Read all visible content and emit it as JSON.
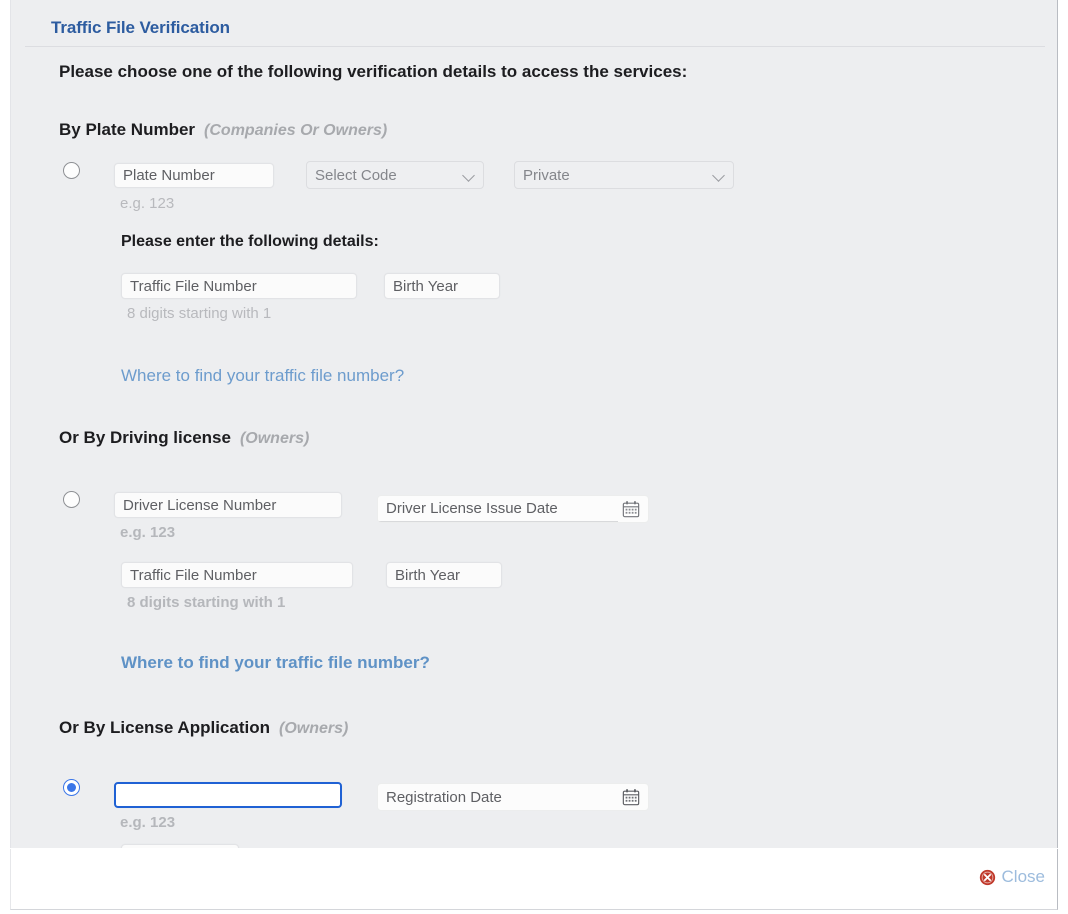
{
  "dialog": {
    "title": "Traffic File Verification",
    "intro": "Please choose one of the following verification details to access the services:",
    "close_label": "Close",
    "close_icon": "close-circle-icon",
    "accent_color": "#2d5ca0",
    "close_icon_color": "#c0392b",
    "link_color": "#6d9ccd",
    "selected_radio_color": "#3b76e8",
    "background_color": "#edeef0"
  },
  "sections": [
    {
      "heading": "By Plate Number",
      "audience": "(Companies Or Owners)",
      "selected": false,
      "plate_number_placeholder": "Plate Number",
      "plate_number_value": "",
      "plate_hint": "e.g. 123",
      "code_select_value": "Select Code",
      "type_select_value": "Private",
      "sub_heading": "Please enter the following details:",
      "traffic_file_placeholder": "Traffic File Number",
      "traffic_file_value": "",
      "traffic_file_hint": "8 digits starting with 1",
      "birth_year_placeholder": "Birth Year",
      "birth_year_value": "",
      "link": "Where to find your traffic file number?"
    },
    {
      "heading": "Or By Driving license",
      "audience": "(Owners)",
      "selected": false,
      "license_number_placeholder": "Driver License Number",
      "license_number_value": "",
      "license_hint": "e.g. 123",
      "issue_date_placeholder": "Driver License Issue Date",
      "issue_date_value": "",
      "issue_date_icon": "calendar-icon",
      "traffic_file_placeholder": "Traffic File Number",
      "traffic_file_value": "",
      "traffic_file_hint": "8 digits starting with 1",
      "birth_year_placeholder": "Birth Year",
      "birth_year_value": "",
      "link": "Where to find your traffic file number?"
    },
    {
      "heading": "Or By License Application",
      "audience": "(Owners)",
      "selected": true,
      "application_number_placeholder": "",
      "application_number_value": "",
      "application_hint": "e.g. 123",
      "registration_date_placeholder": "Registration Date",
      "registration_date_value": "",
      "registration_date_icon": "calendar-icon"
    }
  ]
}
